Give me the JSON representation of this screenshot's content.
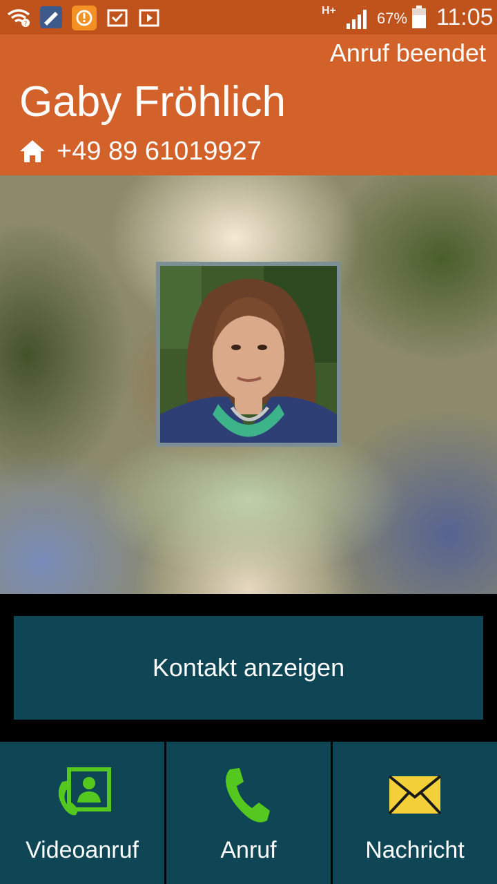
{
  "status_bar": {
    "battery_percent": "67%",
    "time": "11:05",
    "network": "H+",
    "icons": [
      "wifi-icon",
      "notification-app-icon",
      "download-icon",
      "clipboard-icon",
      "media-icon",
      "network-type-icon",
      "signal-icon",
      "battery-icon"
    ]
  },
  "call": {
    "status": "Anruf beendet",
    "contact_name": "Gaby Fröhlich",
    "phone_type_icon": "home-icon",
    "phone_number": "+49 89 61019927"
  },
  "buttons": {
    "view_contact": "Kontakt anzeigen"
  },
  "actions": [
    {
      "label": "Videoanruf",
      "icon": "video-call-icon"
    },
    {
      "label": "Anruf",
      "icon": "phone-icon"
    },
    {
      "label": "Nachricht",
      "icon": "message-icon"
    }
  ],
  "colors": {
    "status_bar": "#c0521c",
    "header": "#d2612a",
    "button": "#0f4656",
    "accent_green": "#55c81f",
    "envelope_yellow": "#f3cf3a"
  }
}
